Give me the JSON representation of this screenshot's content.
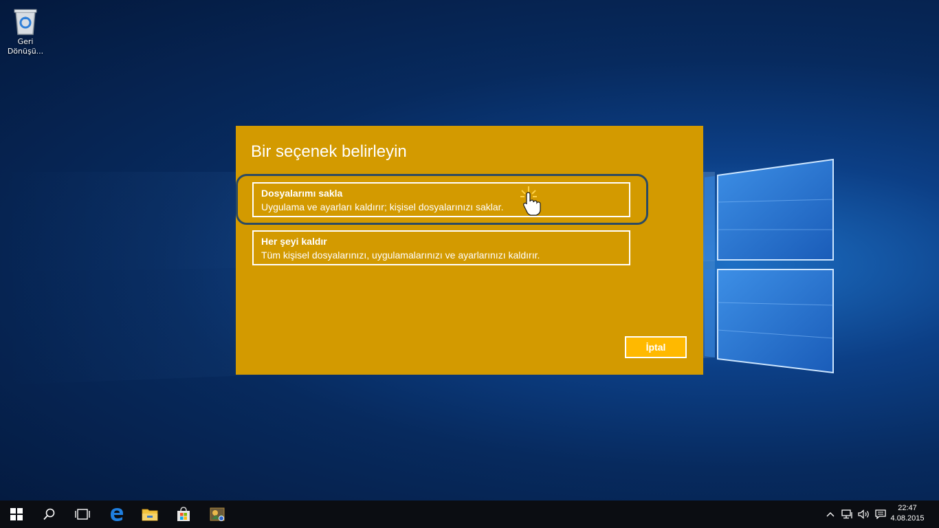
{
  "desktop": {
    "recycle_bin_label_line1": "Geri",
    "recycle_bin_label_line2": "Dönüşü..."
  },
  "dialog": {
    "title": "Bir seçenek belirleyin",
    "options": [
      {
        "title": "Dosyalarımı sakla",
        "description": "Uygulama ve ayarları kaldırır; kişisel dosyalarınızı saklar."
      },
      {
        "title": "Her şeyi kaldır",
        "description": "Tüm kişisel dosyalarınızı, uygulamalarınızı ve ayarlarınızı kaldırır."
      }
    ],
    "cancel_label": "İptal"
  },
  "taskbar": {
    "icons": [
      "windows-start-icon",
      "search-icon",
      "task-view-icon",
      "edge-browser-icon",
      "file-explorer-icon",
      "store-icon",
      "app-icon"
    ],
    "tray_icons": [
      "chevron-up-icon",
      "network-icon",
      "volume-icon",
      "notification-icon"
    ],
    "time": "22:47",
    "date": "4.08.2015"
  },
  "colors": {
    "dialog_bg": "#d39a00",
    "button_bg": "#ffb900",
    "focus_ring": "#2b4a63",
    "taskbar_bg": "#0b0d12"
  }
}
